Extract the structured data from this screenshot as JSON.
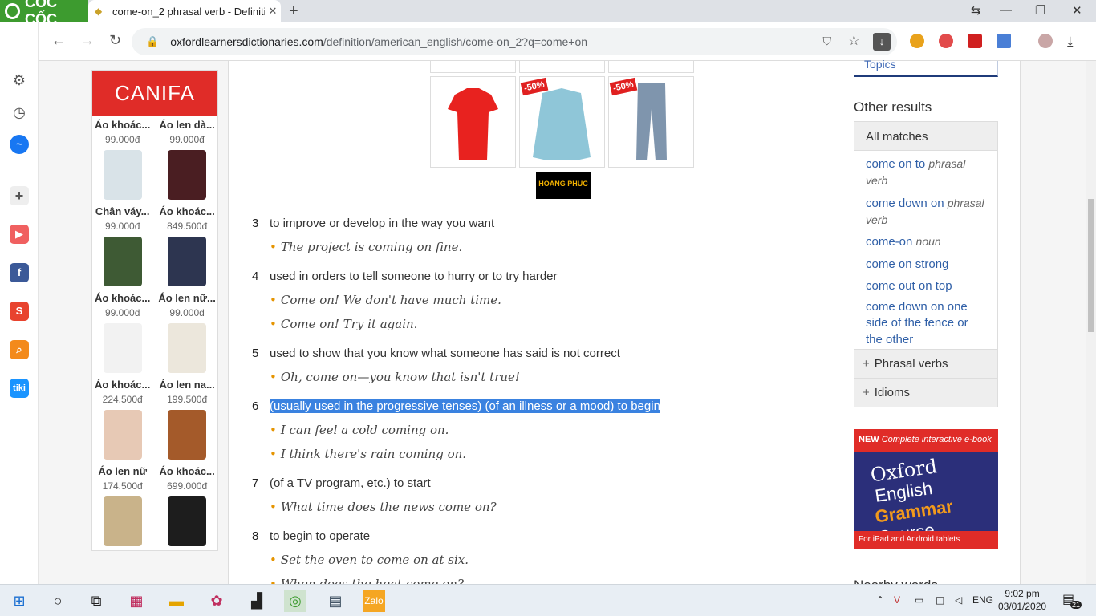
{
  "browser": {
    "brand": "CỐC CỐC",
    "tab_title": "come-on_2 phrasal verb - Definitio",
    "url_domain": "oxfordlearnersdictionaries.com",
    "url_path": "/definition/american_english/come-on_2?q=come+on"
  },
  "ad_left": {
    "brand": "CANIFA",
    "items": [
      {
        "name": "Áo khoác...",
        "price": "99.000đ",
        "color": "#d9e3e8"
      },
      {
        "name": "Áo len dà...",
        "price": "99.000đ",
        "color": "#4a1e22"
      },
      {
        "name": "Chân váy...",
        "price": "99.000đ",
        "color": "#3e5a34"
      },
      {
        "name": "Áo khoác...",
        "price": "849.500đ",
        "color": "#2d3550"
      },
      {
        "name": "Áo khoác...",
        "price": "99.000đ",
        "color": "#f2f2f2"
      },
      {
        "name": "Áo len nữ...",
        "price": "99.000đ",
        "color": "#ece7dc"
      },
      {
        "name": "Áo khoác...",
        "price": "224.500đ",
        "color": "#e7c9b5"
      },
      {
        "name": "Áo len na...",
        "price": "199.500đ",
        "color": "#a45a2a"
      },
      {
        "name": "Áo len nữ",
        "price": "174.500đ",
        "color": "#c9b38a"
      },
      {
        "name": "Áo khoác...",
        "price": "699.000đ",
        "color": "#1d1d1d"
      }
    ]
  },
  "ad_products": {
    "sale_badge": "-50%",
    "brand": "HOANG PHUC"
  },
  "senses": [
    {
      "num": "3",
      "def": "to improve or develop in the way you want",
      "examples": [
        "The project is coming on fine."
      ]
    },
    {
      "num": "4",
      "def": "used in orders to tell someone to hurry or to try harder",
      "examples": [
        "Come on! We don't have much time.",
        "Come on! Try it again."
      ]
    },
    {
      "num": "5",
      "def": "used to show that you know what someone has said is not correct",
      "examples": [
        "Oh, come on—you know that isn't true!"
      ]
    },
    {
      "num": "6",
      "def": "(usually used in the progressive tenses) (of an illness or a mood) to begin",
      "examples": [
        "I can feel a cold coming on.",
        "I think there's rain coming on."
      ]
    },
    {
      "num": "7",
      "def": "(of a TV program, etc.) to start",
      "examples": [
        "What time does the news come on?"
      ]
    },
    {
      "num": "8",
      "def": "to begin to operate",
      "examples": [
        "Set the oven to come on at six.",
        "When does the heat come on?"
      ]
    }
  ],
  "right": {
    "topics": "Topics",
    "other_results": "Other results",
    "all_matches": "All matches",
    "results": [
      {
        "text": "come on to",
        "pos": "phrasal verb"
      },
      {
        "text": "come down on",
        "pos": "phrasal verb"
      },
      {
        "text": "come-on",
        "pos": "noun"
      },
      {
        "text": "come on strong",
        "pos": ""
      },
      {
        "text": "come out on top",
        "pos": ""
      },
      {
        "text": "come down on one side of the fence or the other",
        "pos": ""
      }
    ],
    "phrasal_verbs": "Phrasal verbs",
    "idioms": "Idioms",
    "nearby": "Nearby words"
  },
  "oxford_ad": {
    "new": "NEW",
    "headline": "Complete interactive e-book",
    "line1": "Oxford",
    "line2": "English",
    "line3": "Grammar",
    "line4": "Course",
    "footer": "For iPad and Android tablets"
  },
  "taskbar": {
    "lang": "ENG",
    "time": "9:02 pm",
    "date": "03/01/2020",
    "notifications": "21"
  }
}
